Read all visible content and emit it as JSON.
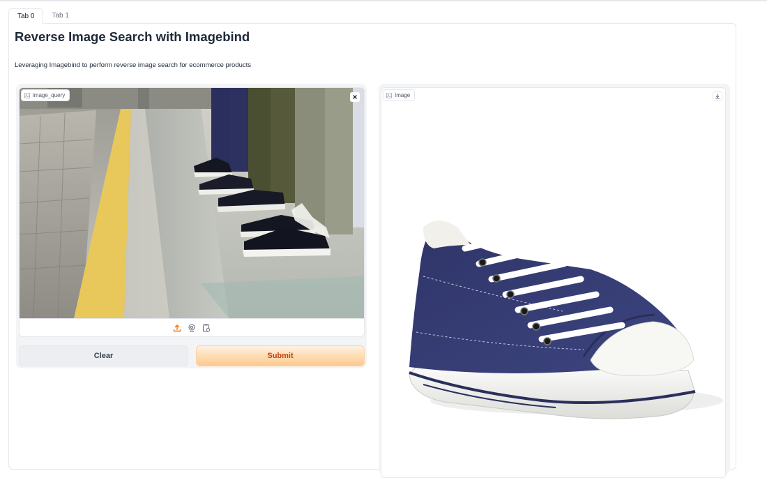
{
  "tabs": [
    {
      "label": "Tab 0",
      "active": true
    },
    {
      "label": "Tab 1",
      "active": false
    }
  ],
  "page": {
    "title": "Reverse Image Search with Imagebind",
    "description": "Leveraging Imagebind to perform reverse image search for ecommerce products"
  },
  "input_image": {
    "label": "image_query",
    "label_icon": "image-icon",
    "close_icon": "close-icon",
    "source_icons": [
      "upload-icon",
      "webcam-icon",
      "clipboard-icon"
    ]
  },
  "buttons": {
    "clear_label": "Clear",
    "submit_label": "Submit"
  },
  "output_image": {
    "label": "Image",
    "label_icon": "image-icon",
    "download_icon": "download-icon"
  },
  "colors": {
    "accent": "#f97316",
    "submit_bg": "#fdc98c",
    "submit_text": "#c2410c",
    "clear_bg": "#eceef1",
    "border": "#e5e7eb"
  }
}
